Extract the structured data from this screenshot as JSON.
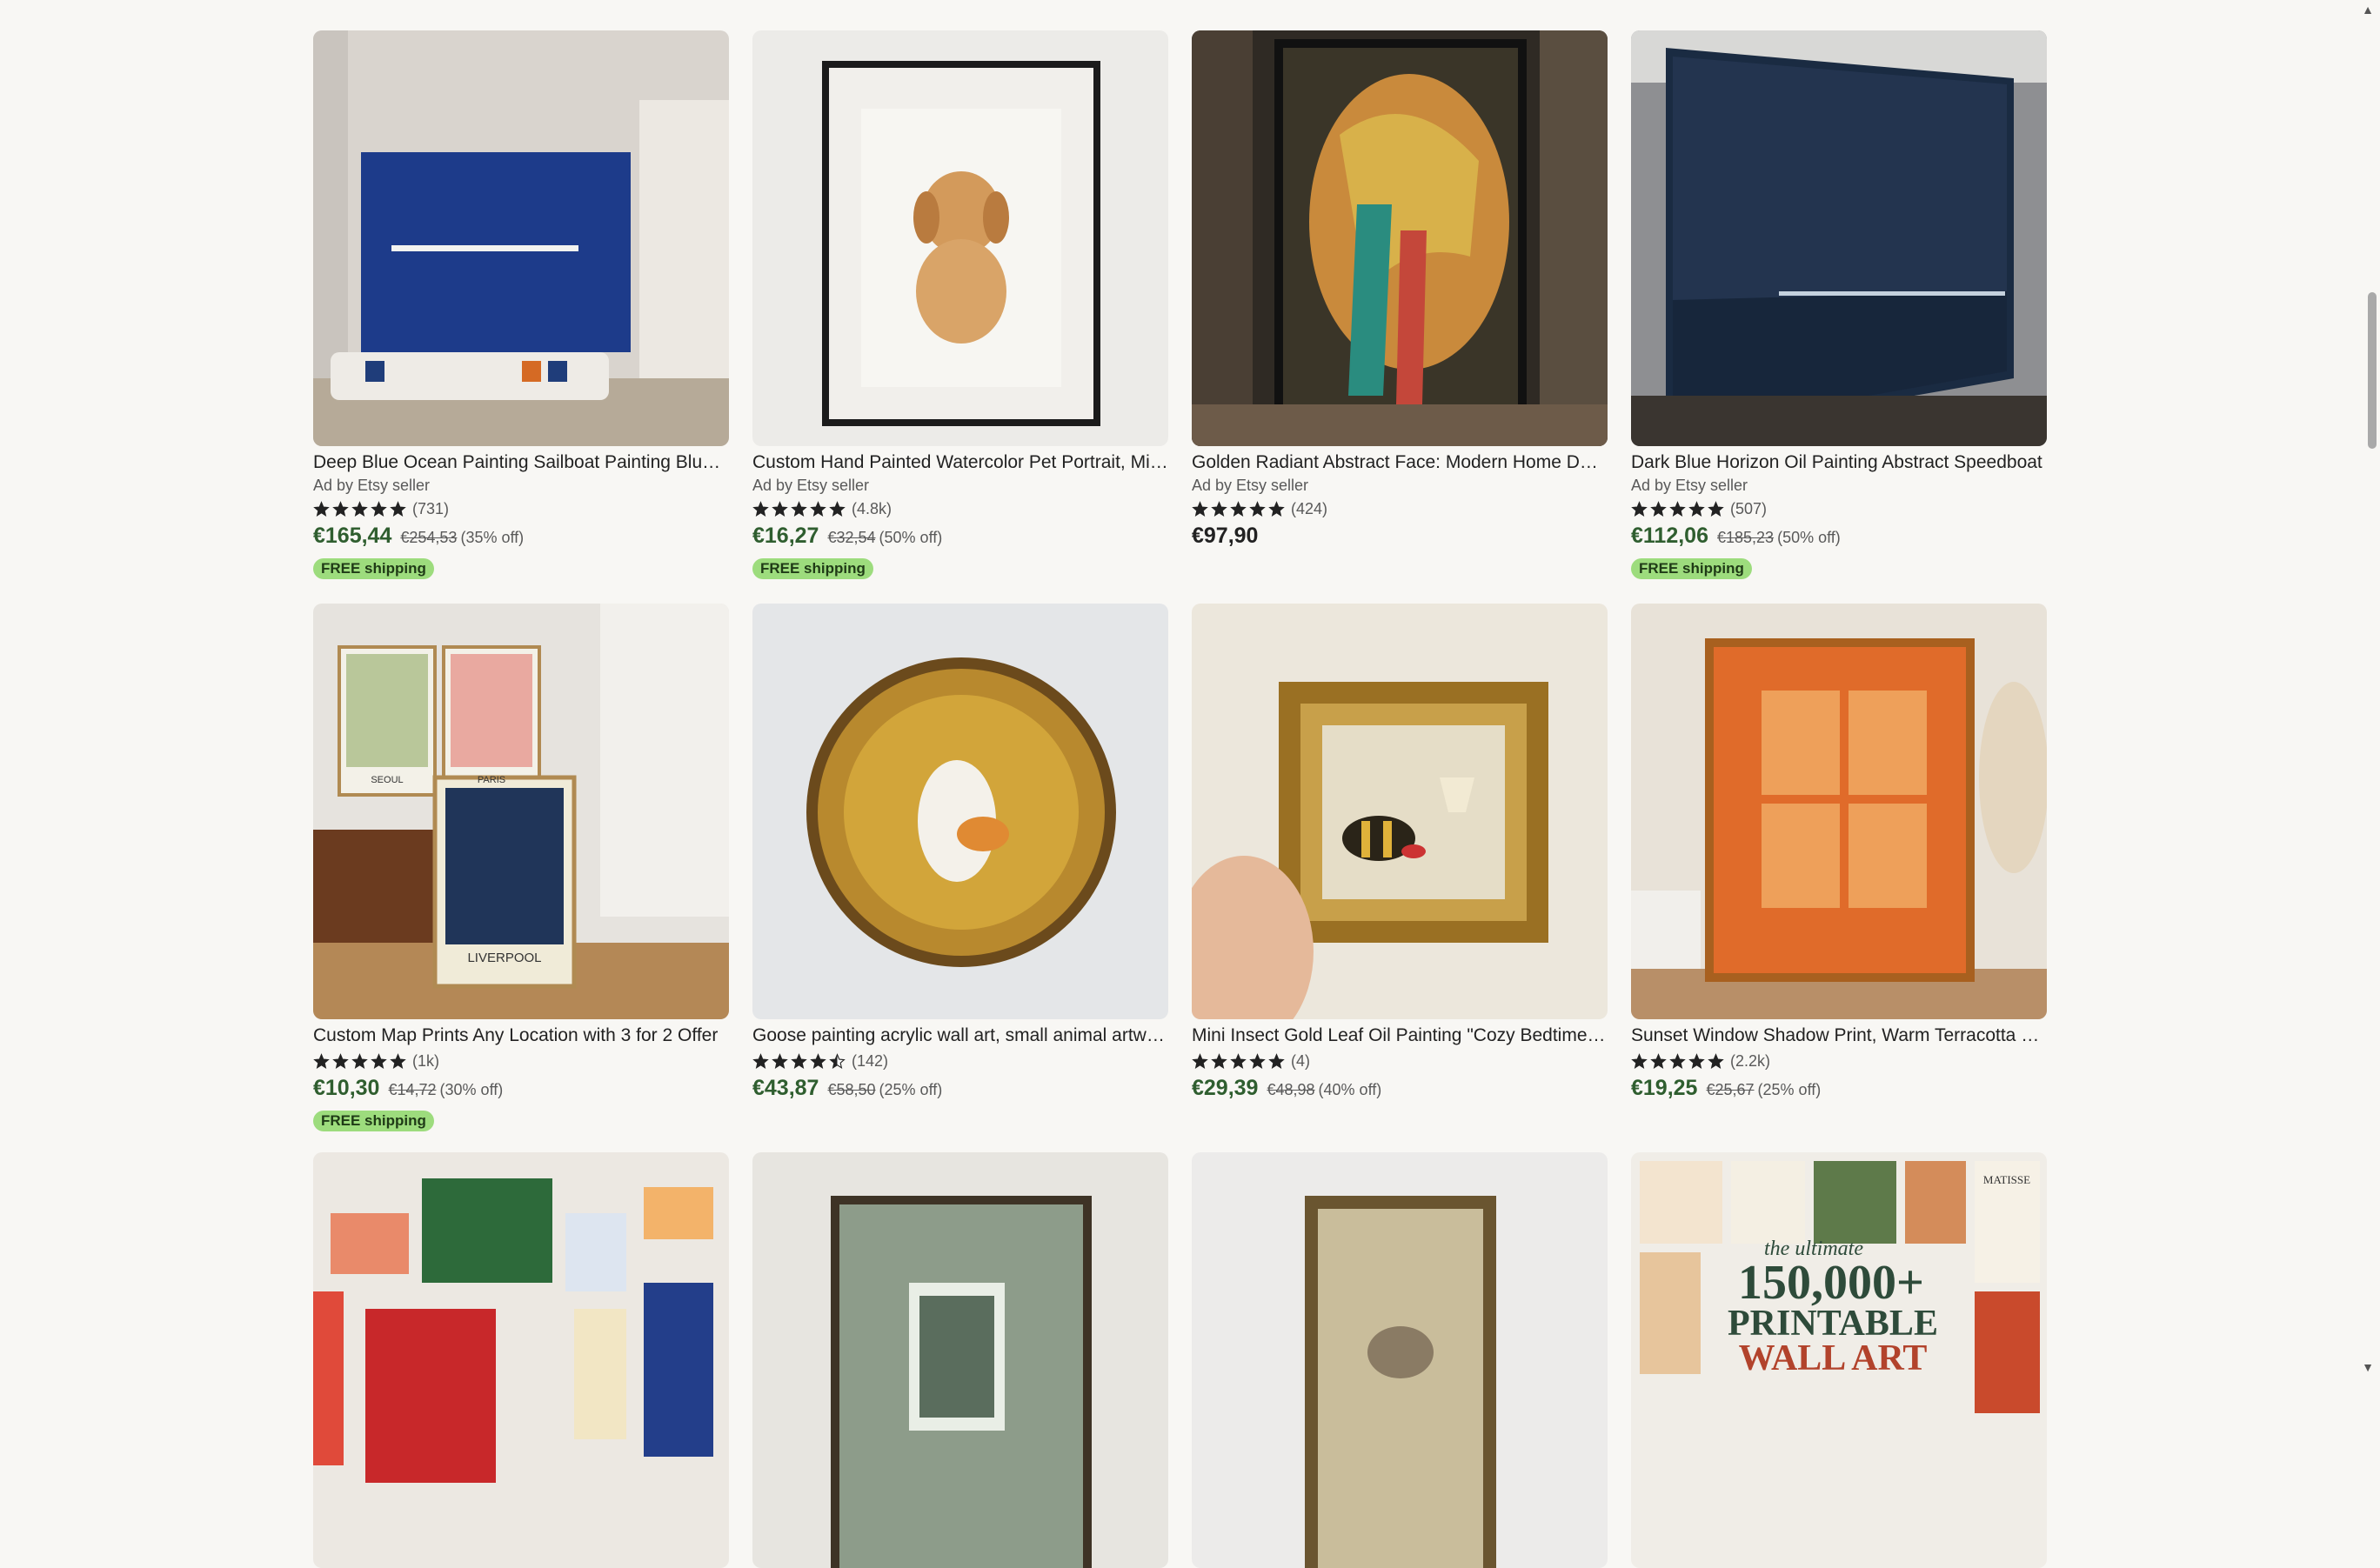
{
  "listings": [
    {
      "title": "Deep Blue Ocean Painting Sailboat Painting Blue Abstract Painting",
      "seller": "Ad by Etsy seller",
      "reviews": "(731)",
      "price": "€165,44",
      "original": "€254,53",
      "discount": "(35% off)",
      "badge": "FREE shipping"
    },
    {
      "title": "Custom Hand Painted Watercolor Pet Portrait, Minimalist",
      "seller": "Ad by Etsy seller",
      "reviews": "(4.8k)",
      "price": "€16,27",
      "original": "€32,54",
      "discount": "(50% off)",
      "badge": "FREE shipping"
    },
    {
      "title": "Golden Radiant Abstract Face: Modern Home Decor",
      "seller": "Ad by Etsy seller",
      "reviews": "(424)",
      "price": "€97,90"
    },
    {
      "title": "Dark Blue Horizon Oil Painting Abstract Speedboat",
      "seller": "Ad by Etsy seller",
      "reviews": "(507)",
      "price": "€112,06",
      "original": "€185,23",
      "discount": "(50% off)",
      "badge": "FREE shipping"
    },
    {
      "title": "Custom Map Prints Any Location with 3 for 2 Offer",
      "reviews": "(1k)",
      "price": "€10,30",
      "original": "€14,72",
      "discount": "(30% off)",
      "badge": "FREE shipping"
    },
    {
      "title": "Goose painting acrylic wall art, small animal artwork",
      "reviews": "(142)",
      "price": "€43,87",
      "original": "€58,50",
      "discount": "(25% off)",
      "rating": 4.5
    },
    {
      "title": "Mini Insect Gold Leaf Oil Painting \"Cozy Bedtime Bee\"",
      "reviews": "(4)",
      "price": "€29,39",
      "original": "€48,98",
      "discount": "(40% off)"
    },
    {
      "title": "Sunset Window Shadow Print, Warm Terracotta Botanical",
      "reviews": "(2.2k)",
      "price": "€19,25",
      "original": "€25,67",
      "discount": "(25% off)"
    }
  ],
  "thumbs": [
    {
      "art_text": [
        "SEOUL",
        "PARIS",
        "LIVERPOOL"
      ]
    },
    {
      "art_text": [
        "the ultimate",
        "150,000+",
        "PRINTABLE",
        "WALL ART",
        "MATISSE"
      ]
    }
  ],
  "icons": {
    "star": "star-icon",
    "scroll_up": "arrow-up-icon",
    "scroll_down": "arrow-down-icon"
  },
  "colors": {
    "sale_price": "#2f5e2f",
    "badge_bg": "#9ddc7d",
    "background": "#f8f7f4"
  }
}
